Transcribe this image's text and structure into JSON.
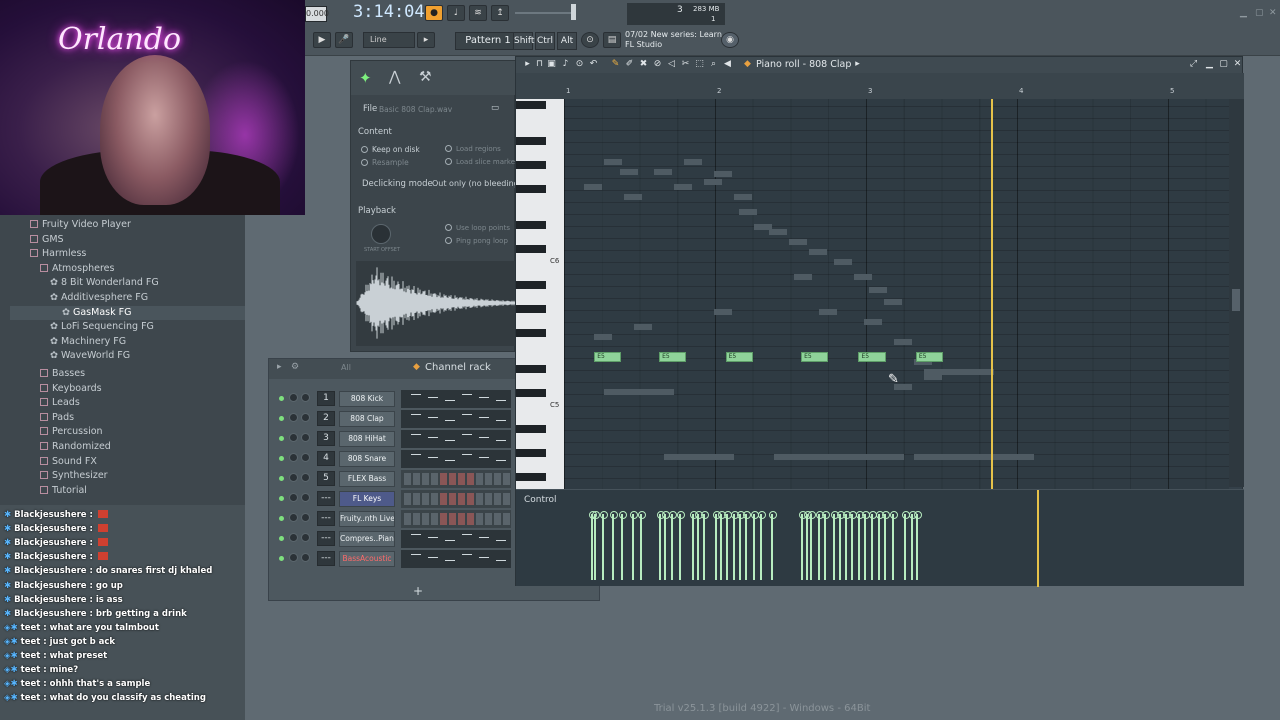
{
  "webcam": {
    "neon_text": "Orlando"
  },
  "toolbar": {
    "bpm": "0.000",
    "clock": "3:14:04",
    "line_mode": "Line",
    "pattern": "Pattern 1",
    "keys": [
      "Shift",
      "Ctrl",
      "Alt"
    ],
    "cpu_value": "3",
    "memory": "283 MB",
    "voices": "1",
    "news_date": "07/02",
    "news_title": "New series: Learn",
    "news_source": "FL Studio"
  },
  "browser": {
    "items": [
      {
        "label": "Fruity Video Player",
        "level": 1
      },
      {
        "label": "GMS",
        "level": 1
      },
      {
        "label": "Harmless",
        "level": 1
      },
      {
        "label": "Atmospheres",
        "level": 2
      },
      {
        "label": "8 Bit Wonderland FG",
        "level": 3
      },
      {
        "label": "Additivesphere FG",
        "level": 3
      },
      {
        "label": "GasMask FG",
        "level": 3
      },
      {
        "label": "LoFi Sequencing FG",
        "level": 3
      },
      {
        "label": "Machinery FG",
        "level": 3
      },
      {
        "label": "WaveWorld FG",
        "level": 3
      },
      {
        "label": "Basses",
        "level": 2
      },
      {
        "label": "Keyboards",
        "level": 2
      },
      {
        "label": "Leads",
        "level": 2
      },
      {
        "label": "Pads",
        "level": 2
      },
      {
        "label": "Percussion",
        "level": 2
      },
      {
        "label": "Randomized",
        "level": 2
      },
      {
        "label": "Sound FX",
        "level": 2
      },
      {
        "label": "Synthesizer",
        "level": 2
      },
      {
        "label": "Tutorial",
        "level": 2
      }
    ]
  },
  "chat": {
    "messages": [
      {
        "user": "Blackjesushere",
        "text": ""
      },
      {
        "user": "Blackjesushere",
        "text": ""
      },
      {
        "user": "Blackjesushere",
        "text": ""
      },
      {
        "user": "Blackjesushere",
        "text": ""
      },
      {
        "user": "Blackjesushere",
        "text": "do snares first dj khaled"
      },
      {
        "user": "Blackjesushere",
        "text": "go up"
      },
      {
        "user": "Blackjesushere",
        "text": "is ass"
      },
      {
        "user": "Blackjesushere",
        "text": "brb getting a drink"
      },
      {
        "user": "teet",
        "text": "what are you talmbout"
      },
      {
        "user": "teet",
        "text": "just got b ack"
      },
      {
        "user": "teet",
        "text": "what preset"
      },
      {
        "user": "teet",
        "text": "mine?"
      },
      {
        "user": "teet",
        "text": "ohhh that's a sample"
      },
      {
        "user": "teet",
        "text": "what do you classify as cheating"
      }
    ]
  },
  "channel_settings": {
    "file_label": "File",
    "file_name": "Basic 808 Clap.wav",
    "content_label": "Content",
    "keep_on_disk": "Keep on disk",
    "resample": "Resample",
    "load_regions": "Load regions",
    "load_slice_markers": "Load slice markers",
    "declicking_label": "Declicking mode",
    "declicking_value": "Out only (no bleeding)",
    "playback_label": "Playback",
    "start_offset": "START OFFSET",
    "use_loop_points": "Use loop points",
    "ping_pong_loop": "Ping pong loop"
  },
  "channel_rack": {
    "title": "Channel rack",
    "filter": "All",
    "add_label": "+",
    "channels": [
      {
        "num": "1",
        "name": "808 Kick"
      },
      {
        "num": "2",
        "name": "808 Clap"
      },
      {
        "num": "3",
        "name": "808 HiHat"
      },
      {
        "num": "4",
        "name": "808 Snare"
      },
      {
        "num": "5",
        "name": "FLEX Bass"
      },
      {
        "num": "---",
        "name": "FL Keys"
      },
      {
        "num": "---",
        "name": "Fruity..nth Live"
      },
      {
        "num": "---",
        "name": "Compres..Piano"
      },
      {
        "num": "---",
        "name": "BassAcoustic"
      }
    ]
  },
  "piano_roll": {
    "title": "Piano roll - 808 Clap",
    "bars": [
      "1",
      "2",
      "3",
      "4",
      "5"
    ],
    "octave_labels": [
      "C6",
      "C5",
      "C4"
    ],
    "control_label": "Control",
    "notes": [
      {
        "label": "E5",
        "bar": 1.2,
        "len": 0.18,
        "pitch": 64
      },
      {
        "label": "E5",
        "bar": 1.63,
        "len": 0.18,
        "pitch": 64
      },
      {
        "label": "E5",
        "bar": 2.07,
        "len": 0.18,
        "pitch": 64
      },
      {
        "label": "E5",
        "bar": 2.57,
        "len": 0.18,
        "pitch": 64
      },
      {
        "label": "E5",
        "bar": 2.95,
        "len": 0.18,
        "pitch": 64
      },
      {
        "label": "E5",
        "bar": 3.33,
        "len": 0.18,
        "pitch": 64
      },
      {
        "label": "D4",
        "bar": 1.83,
        "len": 0.17,
        "pitch": 50
      },
      {
        "label": "C#4",
        "bar": 2.0,
        "len": 0.18,
        "pitch": 49
      },
      {
        "label": "D4",
        "bar": 2.25,
        "len": 0.17,
        "pitch": 50
      },
      {
        "label": "D4",
        "bar": 2.8,
        "len": 0.17,
        "pitch": 50
      },
      {
        "label": "C#4",
        "bar": 2.99,
        "len": 0.17,
        "pitch": 49
      },
      {
        "label": "D4",
        "bar": 3.25,
        "len": 0.17,
        "pitch": 50
      }
    ],
    "playhead_bar": 3.83,
    "velocities": [
      1.18,
      1.2,
      1.25,
      1.32,
      1.38,
      1.45,
      1.5,
      1.63,
      1.66,
      1.71,
      1.76,
      1.85,
      1.88,
      1.92,
      2.0,
      2.03,
      2.07,
      2.12,
      2.16,
      2.2,
      2.25,
      2.3,
      2.37,
      2.57,
      2.6,
      2.63,
      2.68,
      2.72,
      2.78,
      2.82,
      2.86,
      2.9,
      2.95,
      2.99,
      3.03,
      3.08,
      3.12,
      3.17,
      3.25,
      3.3,
      3.33
    ]
  },
  "status": {
    "text": "Trial v25.1.3 [build 4922] - Windows - 64Bit"
  }
}
